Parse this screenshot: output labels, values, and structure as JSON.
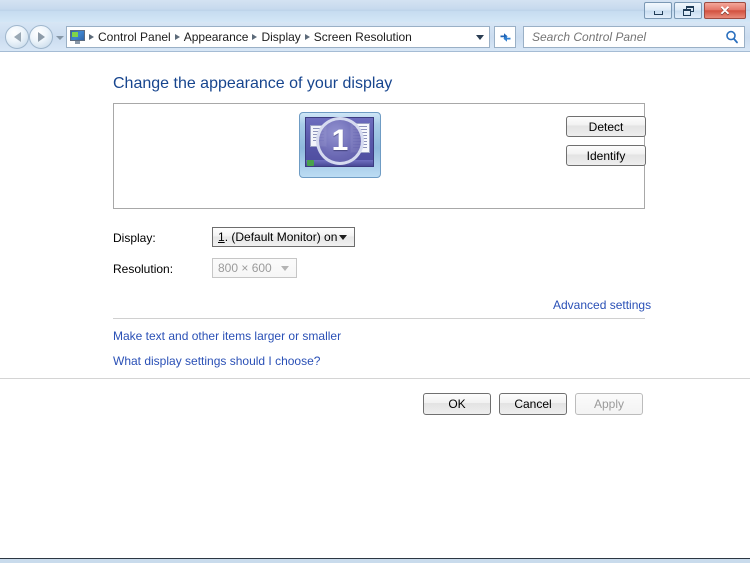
{
  "window": {
    "buttons": {
      "minimize": "Minimize",
      "restore": "Restore",
      "close": "Close",
      "close_glyph": "✕"
    }
  },
  "navbar": {
    "back_label": "Back",
    "forward_label": "Forward",
    "recent_pages_label": "Recent pages",
    "breadcrumb": [
      "Control Panel",
      "Appearance",
      "Display",
      "Screen Resolution"
    ],
    "address_dropdown_label": "Previous locations",
    "refresh_label": "Refresh",
    "search": {
      "placeholder": "Search Control Panel",
      "value": ""
    }
  },
  "page": {
    "title": "Change the appearance of your display"
  },
  "preview": {
    "monitor_number": "1",
    "detect_label": "Detect",
    "identify_label": "Identify"
  },
  "fields": {
    "display_label": "Display:",
    "display_value_prefix": "1",
    "display_value_rest": ". (Default Monitor) on",
    "resolution_label": "Resolution:",
    "resolution_value": "800 × 600"
  },
  "links": {
    "advanced_settings": "Advanced settings",
    "make_text_larger": "Make text and other items larger or smaller",
    "what_settings": "What display settings should I choose?"
  },
  "footer": {
    "ok_label": "OK",
    "cancel_label": "Cancel",
    "apply_label": "Apply"
  },
  "colors": {
    "title_text": "#17458e",
    "link": "#2a50b6",
    "titlebar_start": "#d4e3f2",
    "titlebar_end": "#d3e6f6",
    "close_button": "#d2513f",
    "monitor_screen": "#5a59ab"
  }
}
